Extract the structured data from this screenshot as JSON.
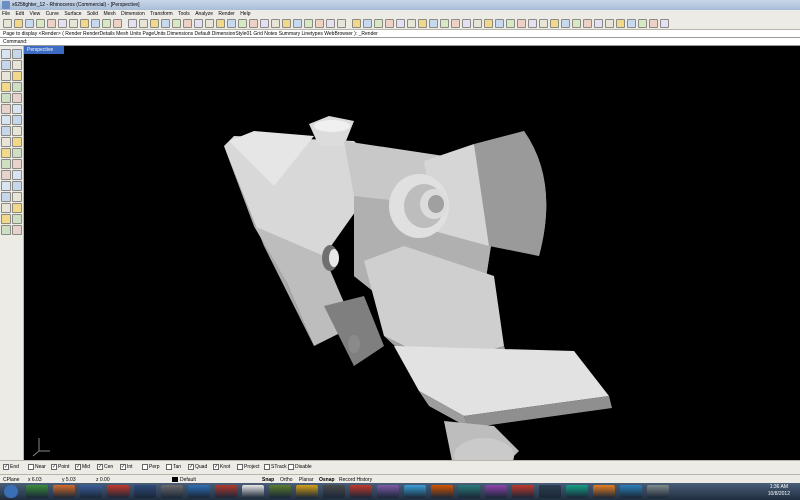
{
  "window": {
    "title": "x625fighter_12 - Rhinoceros (Commercial) - [Perspective]"
  },
  "menu": [
    "File",
    "Edit",
    "View",
    "Curve",
    "Surface",
    "Solid",
    "Mesh",
    "Dimension",
    "Transform",
    "Tools",
    "Analyze",
    "Render",
    "Help"
  ],
  "command_history": "Page to display <Render> ( Render RenderDetails Mesh Units PageUnits Dimensions Default DimensionStyle01 Grid Notes Summary Linetypes WebBrowser ): _Render",
  "command_prompt": "Command:",
  "viewport": {
    "label": "Perspective"
  },
  "osnaps": [
    {
      "label": "End",
      "checked": true
    },
    {
      "label": "Near",
      "checked": false
    },
    {
      "label": "Point",
      "checked": true
    },
    {
      "label": "Mid",
      "checked": true
    },
    {
      "label": "Cen",
      "checked": true
    },
    {
      "label": "Int",
      "checked": true
    },
    {
      "label": "Perp",
      "checked": false
    },
    {
      "label": "Tan",
      "checked": false
    },
    {
      "label": "Quad",
      "checked": true
    },
    {
      "label": "Knot",
      "checked": true
    },
    {
      "label": "Project",
      "checked": false
    },
    {
      "label": "STrack",
      "checked": false
    },
    {
      "label": "Disable",
      "checked": false
    }
  ],
  "status": {
    "cplane": "CPlane",
    "x": "x 6.03",
    "y": "y 5.03",
    "z": "z 0.00",
    "layer": "Default",
    "snap": "Snap",
    "ortho": "Ortho",
    "planar": "Planar",
    "osnap": "Osnap",
    "record_history": "Record History"
  },
  "clock": {
    "time": "1:36 AM",
    "date": "10/8/2012"
  },
  "colors": {
    "viewport_bg": "#000000",
    "tab_active": "#3d6bc3",
    "model": "#b9b9b9"
  }
}
